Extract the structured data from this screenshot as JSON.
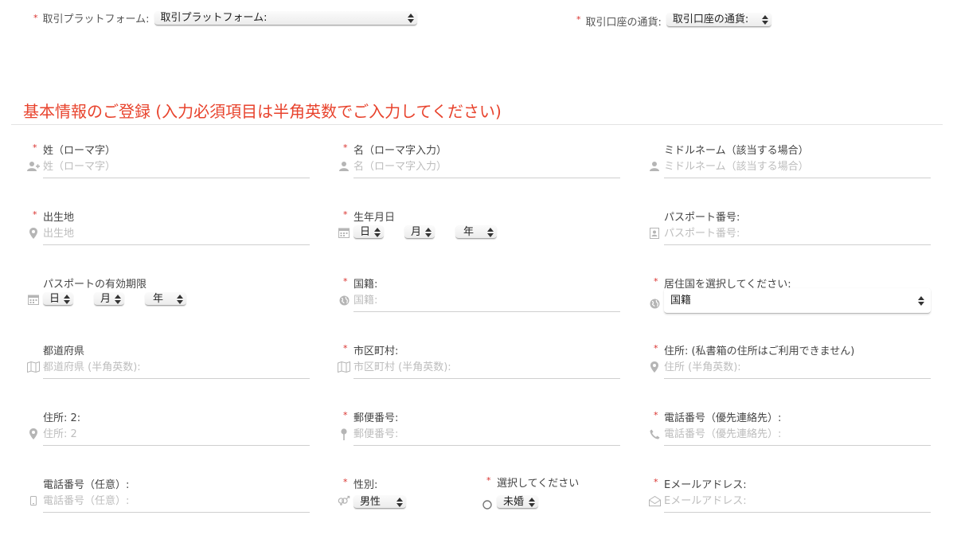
{
  "top": {
    "platform": {
      "required": "*",
      "label": "取引プラットフォーム:",
      "value": "取引プラットフォーム:"
    },
    "currency": {
      "required": "*",
      "label": "取引口座の通貨:",
      "value": "取引口座の通貨:"
    }
  },
  "section_title": "基本情報のご登録 (入力必須項目は半角英数でご入力してください)",
  "fields": {
    "last_name": {
      "required": "*",
      "label": "姓（ローマ字）",
      "placeholder": "姓（ローマ字）",
      "icon": "add-user-icon"
    },
    "first_name": {
      "required": "*",
      "label": "名（ローマ字入力）",
      "placeholder": "名（ローマ字入力）",
      "icon": "user-icon"
    },
    "middle_name": {
      "label": "ミドルネーム（該当する場合）",
      "placeholder": "ミドルネーム（該当する場合）",
      "icon": "user-icon"
    },
    "birthplace": {
      "required": "*",
      "label": "出生地",
      "placeholder": "出生地",
      "icon": "map-marker-icon"
    },
    "birthdate": {
      "required": "*",
      "label": "生年月日",
      "day": "日",
      "month": "月",
      "year": "年",
      "icon": "calendar-icon"
    },
    "passport_number": {
      "label": "パスポート番号:",
      "placeholder": "パスポート番号:",
      "icon": "id-card-icon"
    },
    "passport_expiry": {
      "label": "パスポートの有効期限",
      "day": "日",
      "month": "月",
      "year": "年",
      "icon": "calendar-icon"
    },
    "nationality": {
      "required": "*",
      "label": "国籍:",
      "placeholder": "国籍:",
      "icon": "globe-icon"
    },
    "residence_country": {
      "required": "*",
      "label": "居住国を選択してください:",
      "value": "国籍",
      "icon": "globe-icon"
    },
    "prefecture": {
      "label": "都道府県",
      "placeholder": "都道府県 (半角英数):",
      "icon": "map-icon"
    },
    "city": {
      "required": "*",
      "label": "市区町村:",
      "placeholder": "市区町村 (半角英数):",
      "icon": "map-icon"
    },
    "address1": {
      "required": "*",
      "label": "住所: (私書箱の住所はご利用できません)",
      "placeholder": "住所 (半角英数):",
      "icon": "map-marker-icon"
    },
    "address2": {
      "label": "住所: 2:",
      "placeholder": "住所: 2",
      "icon": "map-marker-icon"
    },
    "postal_code": {
      "required": "*",
      "label": "郵便番号:",
      "placeholder": "郵便番号:",
      "icon": "pin-icon"
    },
    "phone_primary": {
      "required": "*",
      "label": "電話番号（優先連絡先）:",
      "placeholder": "電話番号（優先連絡先）:",
      "icon": "phone-icon"
    },
    "phone_optional": {
      "label": "電話番号（任意）:",
      "placeholder": "電話番号（任意）:",
      "icon": "mobile-icon"
    },
    "gender": {
      "required": "*",
      "label": "性別:",
      "value": "男性",
      "icon": "gender-icon"
    },
    "marital": {
      "required": "*",
      "label": "選択してください",
      "value": "未婚",
      "icon": "circle-icon"
    },
    "email": {
      "required": "*",
      "label": "Eメールアドレス:",
      "placeholder": "Eメールアドレス:",
      "icon": "envelope-icon"
    }
  },
  "colors": {
    "required": "#d9302c",
    "section_title": "#e8432d",
    "icon": "#b5b5b5"
  }
}
